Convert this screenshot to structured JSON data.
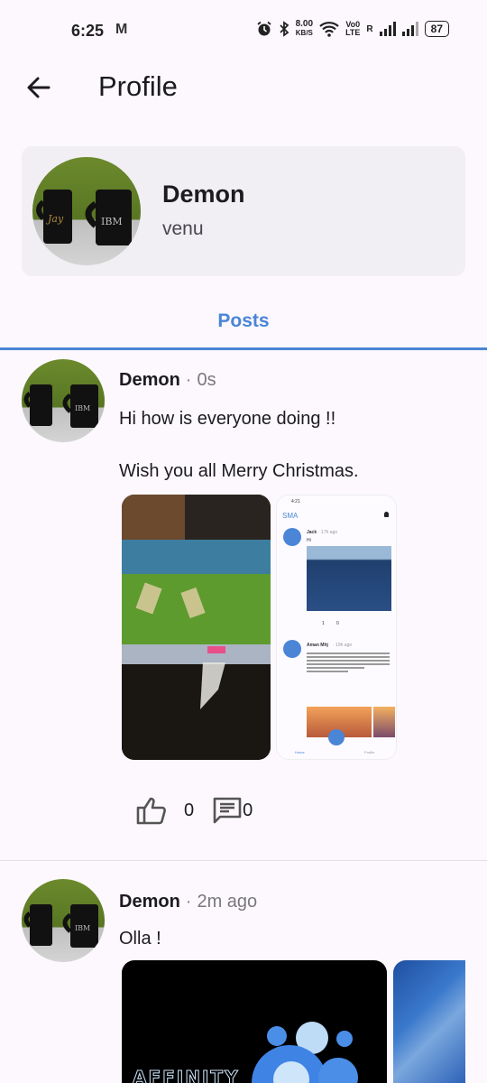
{
  "status_bar": {
    "time": "6:25",
    "gmail_icon": "M",
    "speed_value": "8.00",
    "speed_unit": "KB/S",
    "volte_line1": "Vo0",
    "volte_line2": "LTE",
    "roaming": "R",
    "battery": "87"
  },
  "app_bar": {
    "title": "Profile",
    "back_icon": "arrow-left-icon"
  },
  "profile": {
    "display_name": "Demon",
    "username": "venu"
  },
  "tabs": [
    {
      "label": "Posts",
      "selected": true
    }
  ],
  "accent_color": "#4a85d6",
  "posts": [
    {
      "author": "Demon",
      "separator": "·",
      "time": "0s",
      "text": "Hi how is everyone doing !!\n\nWish you all Merry Christmas.",
      "likes": "0",
      "comments": "0",
      "embedded_screenshot": {
        "time": "4:21",
        "app_name": "SMA",
        "post1_author": "Jack",
        "post1_time": "· 17h ago",
        "post1_text": "Hi",
        "post1_likes": "1",
        "post1_comments": "0",
        "post2_author": "Aman Mhj",
        "post2_time": "· 19h ago",
        "nav_home": "Home",
        "nav_profile": "Profile"
      }
    },
    {
      "author": "Demon",
      "separator": "·",
      "time": "2m ago",
      "text": "Olla !",
      "image_text": "AFFINITY"
    }
  ]
}
